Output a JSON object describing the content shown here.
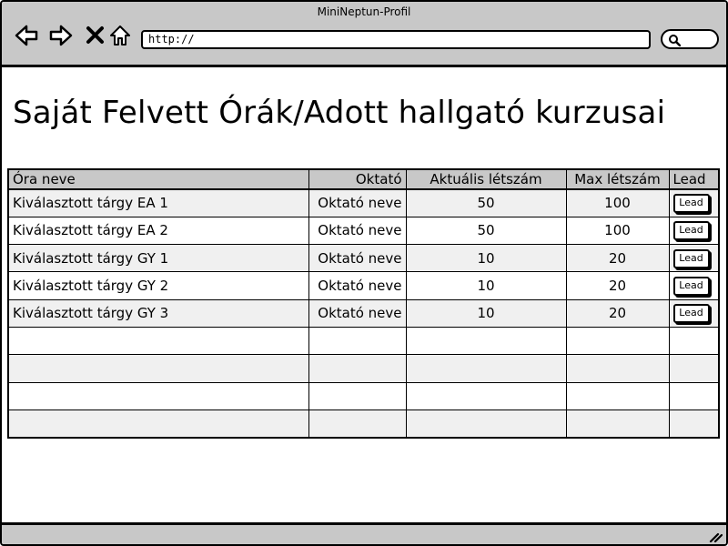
{
  "window": {
    "title": "MiniNeptun-Profil"
  },
  "toolbar": {
    "url": "http://",
    "back_icon": "back-arrow-icon",
    "forward_icon": "forward-arrow-icon",
    "stop_icon": "close-icon",
    "home_icon": "home-icon",
    "search_icon": "search-icon"
  },
  "page": {
    "heading": "Saját Felvett Órák/Adott hallgató kurzusai"
  },
  "table": {
    "headers": {
      "name": "Óra neve",
      "teacher": "Oktató",
      "current": "Aktuális létszám",
      "max": "Max létszám",
      "lead": "Lead"
    },
    "rows": [
      {
        "name": "Kiválasztott tárgy EA 1",
        "teacher": "Oktató neve",
        "current": "50",
        "max": "100",
        "button": "Lead"
      },
      {
        "name": "Kiválasztott tárgy EA 2",
        "teacher": "Oktató neve",
        "current": "50",
        "max": "100",
        "button": "Lead"
      },
      {
        "name": "Kiválasztott tárgy GY 1",
        "teacher": "Oktató neve",
        "current": "10",
        "max": "20",
        "button": "Lead"
      },
      {
        "name": "Kiválasztott tárgy GY 2",
        "teacher": "Oktató neve",
        "current": "10",
        "max": "20",
        "button": "Lead"
      },
      {
        "name": "Kiválasztott tárgy GY 3",
        "teacher": "Oktató neve",
        "current": "10",
        "max": "20",
        "button": "Lead"
      }
    ]
  },
  "colors": {
    "chrome": "#c8c8c8",
    "row_alt": "#f0f0f0",
    "border": "#000000"
  }
}
